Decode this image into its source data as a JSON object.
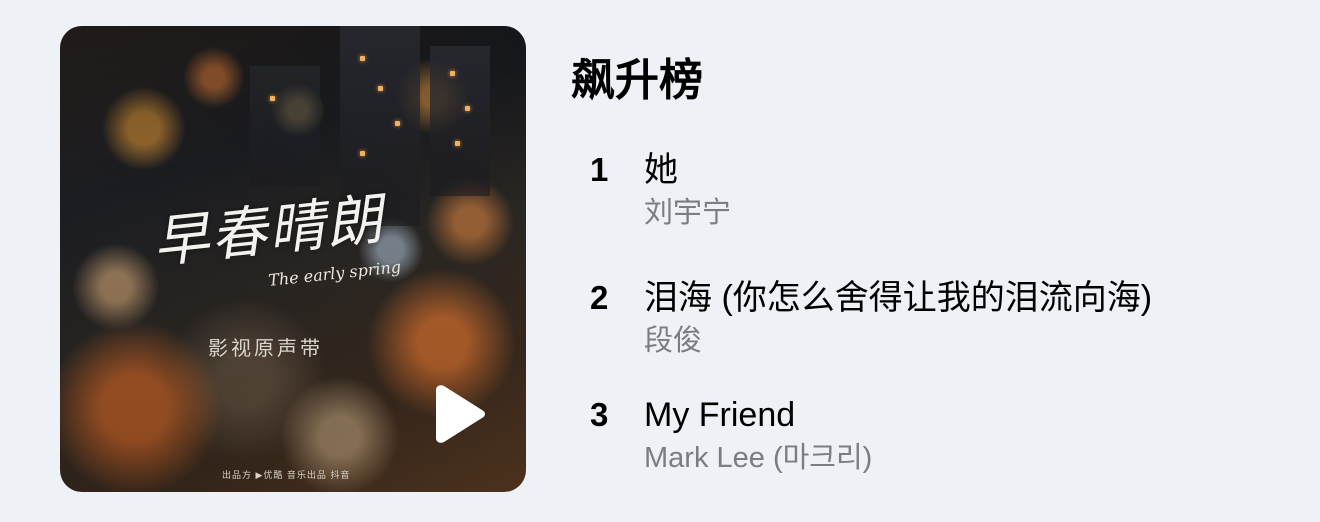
{
  "album": {
    "cover_title": "早春晴朗",
    "cover_subtitle": "The early spring",
    "cover_label": "影视原声带",
    "cover_credits": "出品方  ▶优酷  音乐出品  抖音"
  },
  "chart": {
    "title": "飙升榜",
    "tracks": [
      {
        "rank": "1",
        "title": "她",
        "artist": "刘宇宁"
      },
      {
        "rank": "2",
        "title": "泪海 (你怎么舍得让我的泪流向海)",
        "artist": "段俊"
      },
      {
        "rank": "3",
        "title": "My Friend",
        "artist": "Mark Lee (마크리)"
      }
    ]
  },
  "icons": {
    "play": "play-icon"
  },
  "colors": {
    "background": "#eef1f5",
    "primary_text": "#000000",
    "secondary_text": "#7a7d82",
    "play_icon": "#ffffff"
  }
}
